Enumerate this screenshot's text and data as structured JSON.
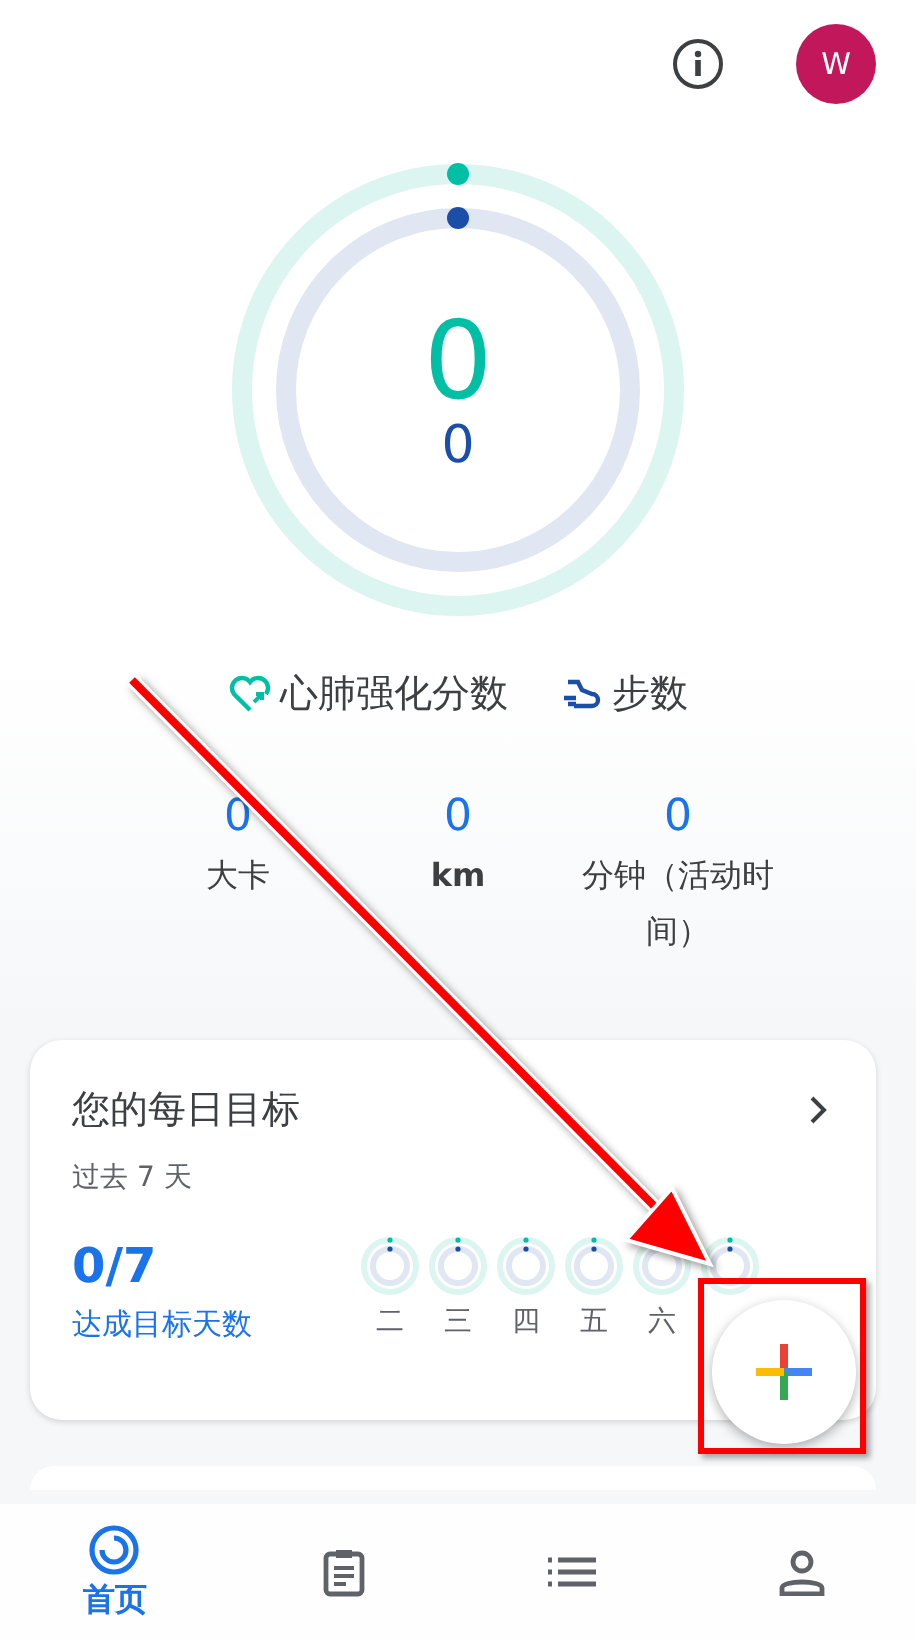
{
  "header": {
    "avatar": "W"
  },
  "rings": {
    "heart_points": {
      "value": "0",
      "level": 0
    },
    "steps": {
      "value": "0",
      "level": 0
    }
  },
  "legend": [
    {
      "kind": "heart",
      "label": "心肺强化分数"
    },
    {
      "kind": "steps",
      "label": "步数"
    }
  ],
  "stats": [
    {
      "value": "0",
      "label": "大卡",
      "bold": false
    },
    {
      "value": "0",
      "label": "km",
      "bold": true
    },
    {
      "value": "0",
      "label": "分钟（活动时间）",
      "bold": false
    }
  ],
  "daily_goal": {
    "title": "您的每日目标",
    "subtitle": "过去 7 天",
    "count": "0/7",
    "caption": "达成目标天数",
    "days": [
      {
        "label": "二",
        "level": 0
      },
      {
        "label": "三",
        "level": 0
      },
      {
        "label": "四",
        "level": 0
      },
      {
        "label": "五",
        "level": 0
      },
      {
        "label": "六",
        "level": 0
      },
      {
        "level": 0
      }
    ]
  },
  "weekly_goal": {
    "visible": true
  },
  "nav": [
    {
      "kind": "home",
      "label": "首页",
      "selected": true
    },
    {
      "kind": "journal",
      "selected": false
    },
    {
      "kind": "list",
      "selected": false
    },
    {
      "kind": "profile",
      "selected": false
    }
  ]
}
